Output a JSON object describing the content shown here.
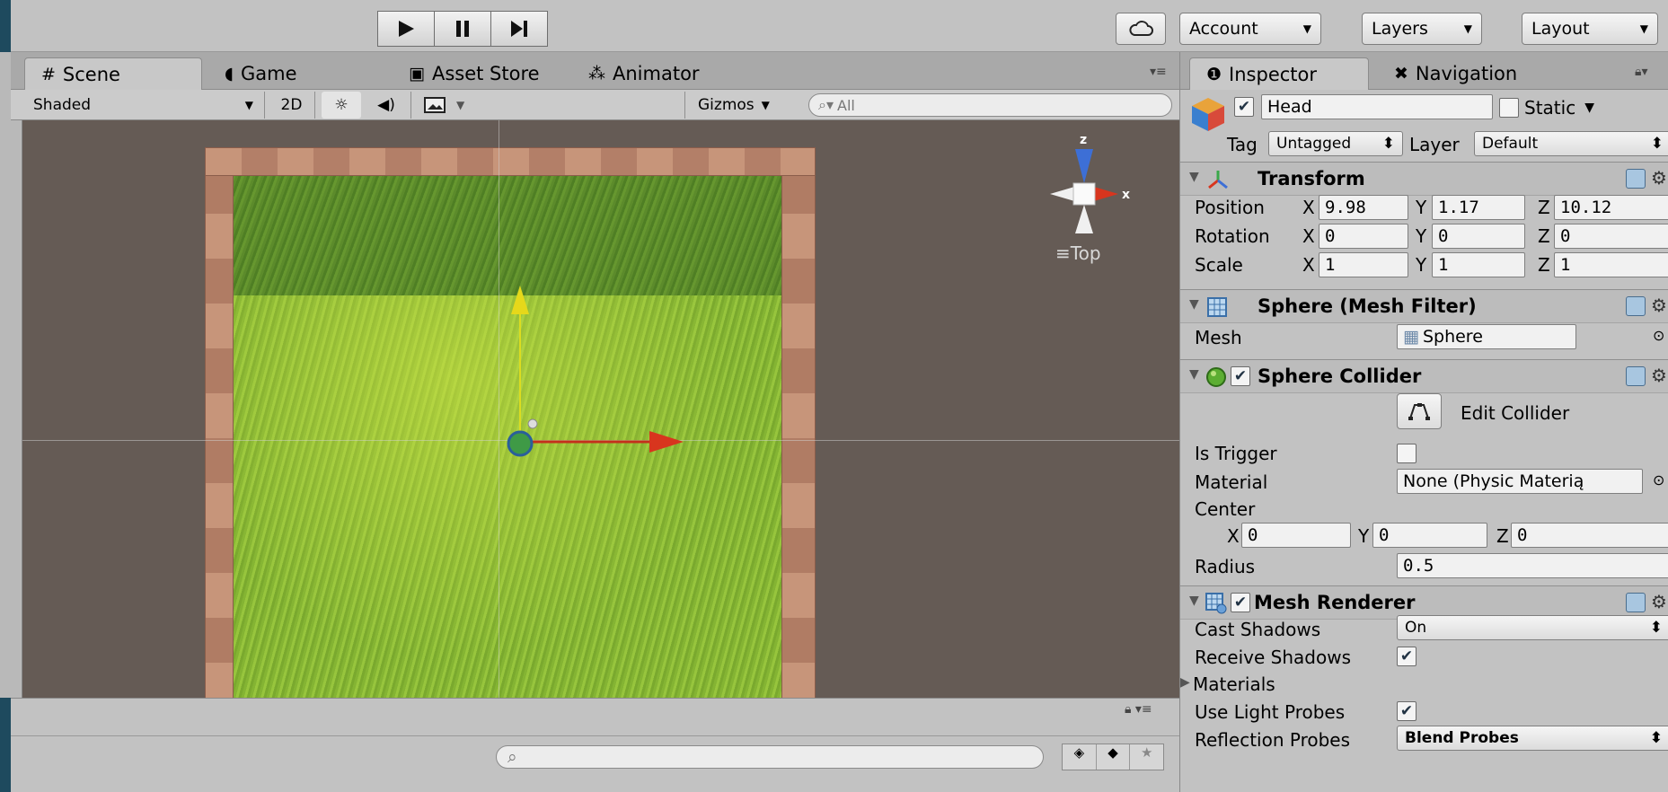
{
  "toolbar": {
    "account_label": "Account",
    "layers_label": "Layers",
    "layout_label": "Layout"
  },
  "scene": {
    "tabs": [
      {
        "label": "Scene",
        "icon": "hash-icon"
      },
      {
        "label": "Game",
        "icon": "pacman-icon"
      },
      {
        "label": "Asset Store",
        "icon": "store-bag-icon"
      },
      {
        "label": "Animator",
        "icon": "animator-icon"
      }
    ],
    "shading_mode": "Shaded",
    "mode_2d": "2D",
    "gizmos_label": "Gizmos",
    "search_placeholder": "All",
    "view_label": "Top",
    "axis_z": "z",
    "axis_x": "x"
  },
  "inspector": {
    "tabs": [
      {
        "label": "Inspector",
        "icon": "info-icon"
      },
      {
        "label": "Navigation",
        "icon": "navigation-icon"
      }
    ],
    "object_name": "Head",
    "static_label": "Static",
    "tag_label": "Tag",
    "tag_value": "Untagged",
    "layer_label": "Layer",
    "layer_value": "Default",
    "transform": {
      "title": "Transform",
      "position_label": "Position",
      "rotation_label": "Rotation",
      "scale_label": "Scale",
      "position": {
        "x": "9.98",
        "y": "1.17",
        "z": "10.12"
      },
      "rotation": {
        "x": "0",
        "y": "0",
        "z": "0"
      },
      "scale": {
        "x": "1",
        "y": "1",
        "z": "1"
      }
    },
    "mesh_filter": {
      "title": "Sphere (Mesh Filter)",
      "mesh_label": "Mesh",
      "mesh_value": "Sphere"
    },
    "sphere_collider": {
      "title": "Sphere Collider",
      "edit_collider_label": "Edit Collider",
      "is_trigger_label": "Is Trigger",
      "material_label": "Material",
      "material_value": "None (Physic Materią",
      "center_label": "Center",
      "center": {
        "x": "0",
        "y": "0",
        "z": "0"
      },
      "radius_label": "Radius",
      "radius_value": "0.5"
    },
    "mesh_renderer": {
      "title": "Mesh Renderer",
      "cast_shadows_label": "Cast Shadows",
      "cast_shadows_value": "On",
      "receive_shadows_label": "Receive Shadows",
      "materials_label": "Materials",
      "use_light_probes_label": "Use Light Probes",
      "reflection_probes_label": "Reflection Probes",
      "reflection_probes_value": "Blend Probes"
    }
  },
  "axis_letters": {
    "x": "X",
    "y": "Y",
    "z": "Z"
  }
}
